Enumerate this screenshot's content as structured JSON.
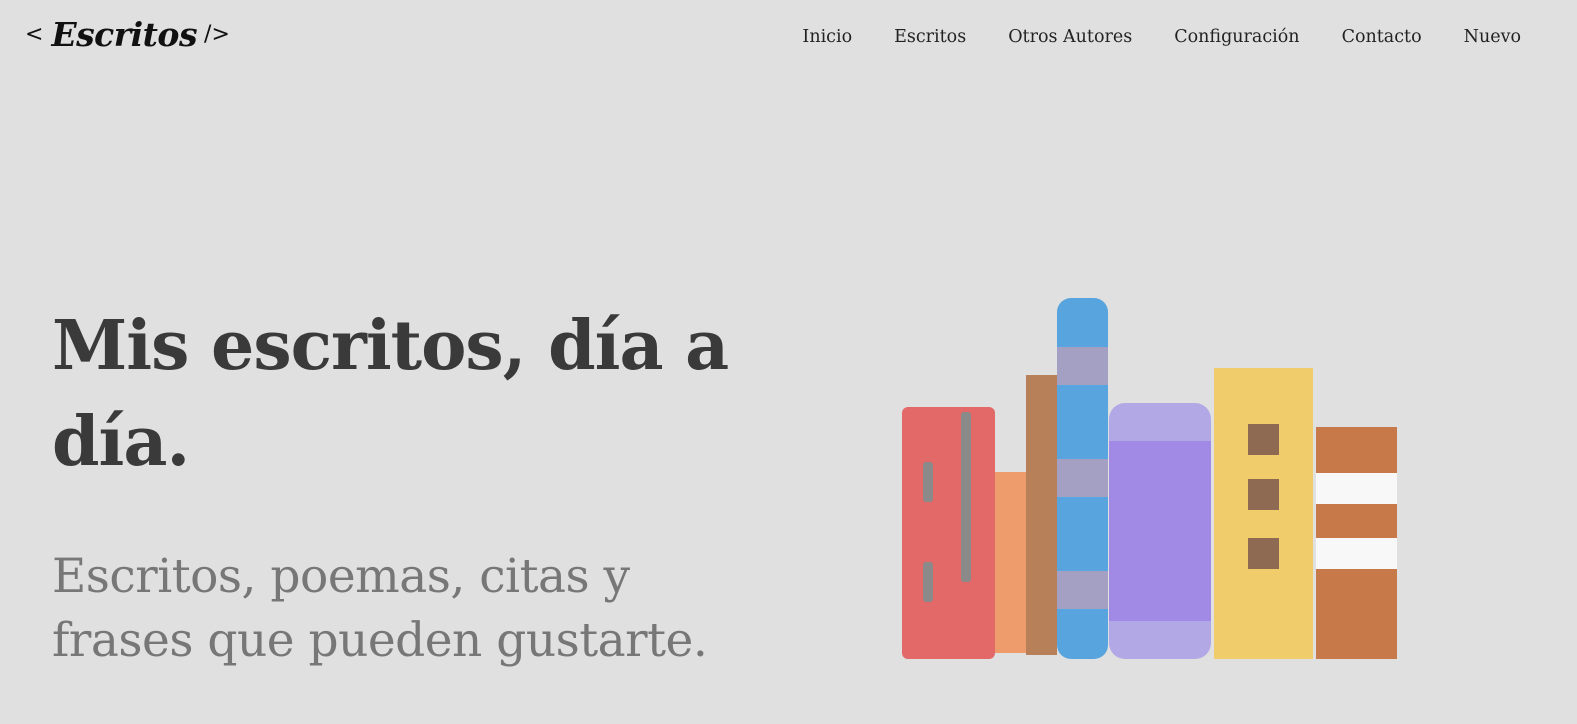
{
  "header": {
    "logo_open": "<",
    "logo_word": "Escritos",
    "logo_close": "/>"
  },
  "nav": {
    "items": [
      {
        "label": "Inicio"
      },
      {
        "label": "Escritos"
      },
      {
        "label": "Otros Autores"
      },
      {
        "label": "Configuración"
      },
      {
        "label": "Contacto"
      },
      {
        "label": "Nuevo"
      }
    ]
  },
  "hero": {
    "title": "Mis escritos, día a día.",
    "subtitle": "Escritos, poemas, citas y frases que pueden gustarte."
  },
  "illustration": {
    "icon": "books-illustration-icon",
    "colors": {
      "red": "#e36868",
      "peach": "#ee9c6b",
      "brown": "#b88058",
      "blue": "#58a4de",
      "lilac": "#a4a0c4",
      "lavender": "#b3a8e6",
      "purple": "#a08ae6",
      "yellow": "#f0cc6a",
      "dark_brown": "#8e6a52",
      "orange": "#c8794a",
      "white": "#f8f8f8",
      "gray": "#8a8a8a"
    }
  }
}
